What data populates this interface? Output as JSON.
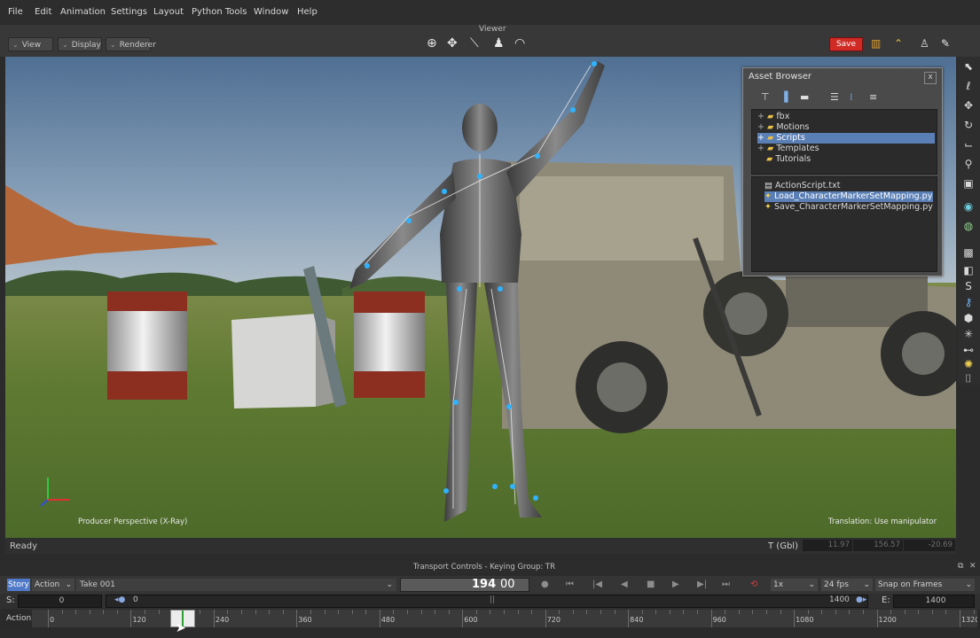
{
  "menu": [
    "File",
    "Edit",
    "Animation",
    "Settings",
    "Layout",
    "Python Tools",
    "Window",
    "Help"
  ],
  "viewer": {
    "title": "Viewer",
    "dropdowns": [
      "View",
      "Display",
      "Renderer"
    ],
    "save_label": "Save",
    "camera_label": "Producer Perspective (X-Ray)",
    "manipulator_label": "Translation: Use manipulator"
  },
  "asset_browser": {
    "title": "Asset Browser",
    "close": "x",
    "tree": [
      "fbx",
      "Motions",
      "Scripts",
      "Templates",
      "Tutorials"
    ],
    "files": [
      "ActionScript.txt",
      "Load_CharacterMarkerSetMapping.py",
      "Save_CharacterMarkerSetMapping.py"
    ]
  },
  "status": {
    "text": "Ready",
    "t_label": "T (Gbl)",
    "t_x": "11.97",
    "t_y": "156.57",
    "t_z": "-20.69"
  },
  "transport": {
    "title": "Transport Controls  -  Keying Group: TR",
    "story_label": "Story",
    "mode": "Action",
    "take": "Take 001",
    "frame": "194",
    "frame_sub": "00",
    "speed": "1x",
    "fps": "24 fps",
    "snap": "Snap on Frames",
    "start_label": "S:",
    "start_value": "0",
    "zoom_start": "0",
    "zoom_end": "1400",
    "end_label": "E:",
    "end_value": "1400",
    "timeline_label": "Action",
    "ticks": [
      "0",
      "120",
      "240",
      "360",
      "480",
      "600",
      "720",
      "840",
      "960",
      "1080",
      "1200",
      "1320"
    ],
    "current_frame": 194
  }
}
